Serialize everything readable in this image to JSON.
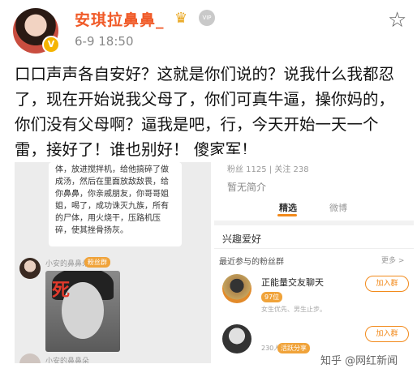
{
  "header": {
    "username": "安琪拉鼻鼻_",
    "crown_glyph": "♛",
    "level_badge": "VIP",
    "verified_badge": "V",
    "time": "6-9 18:50",
    "favorite_icon": "star-icon"
  },
  "post": {
    "text": "口口声声各自安好？这就是你们说的？说我什么我都忍了，现在开始说我父母了，你们可真牛逼，操你妈的，你们没有父母啊？逼我是吧，行，今天开始一天一个雷，接好了！谁也别好！ 傻家军！"
  },
  "screenshot_left": {
    "message": "体，放进搅拌机，给他搞碎了做成汤，然后在里面放敌敌畏，给你鼻鼻，你亲戚朋友，你哥哥姐姐，喝了，成功诛灭九族，所有的尸体，用火烧干，压路机压碎，使其挫骨扬灰。",
    "sender_name": "小安的鼻鼻朵",
    "sender_tag": "粉丝群",
    "photo_overlay": "死",
    "sender_name_2": "小安的鼻鼻朵"
  },
  "screenshot_right": {
    "stats": "粉丝 1125 | 关注 238",
    "intro": "暂无简介",
    "tab_selected": "精选",
    "tab_other": "微博",
    "interest": "兴趣爱好",
    "recent_groups": "最近参与的粉丝群",
    "more": "更多 >",
    "group1_name": "正能量交友聊天",
    "group1_tag": "97位",
    "group1_sub": "女生优先、男生止步。",
    "join_label": "加入群",
    "group2_num": "230人",
    "group2_tag": "活跃分享"
  },
  "watermark": "知乎 @网红新闻"
}
